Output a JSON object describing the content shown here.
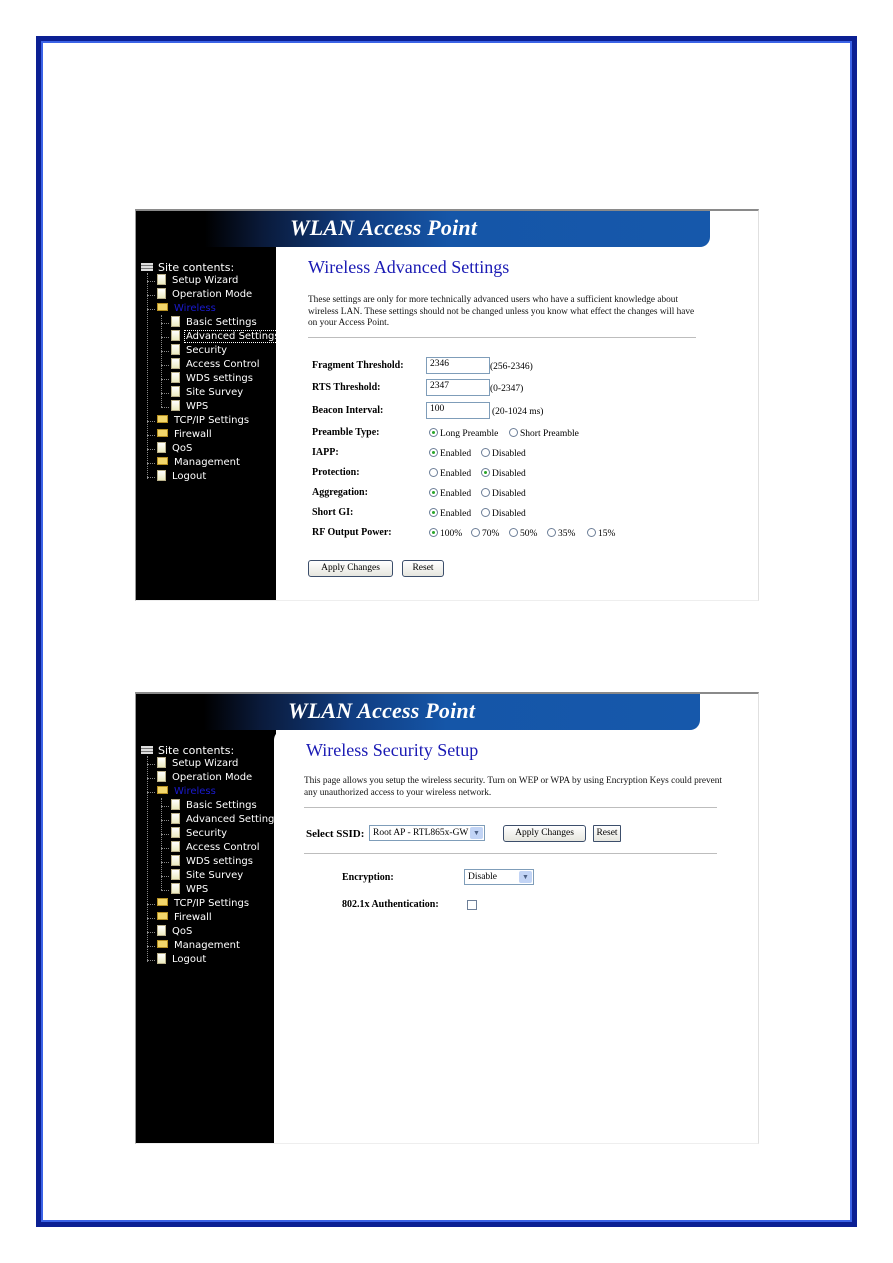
{
  "colors": {
    "page_border": "#0b1f93",
    "banner_blue": "#1658ab",
    "title_blue": "#1a1ab4",
    "sidebar_bg": "#000000"
  },
  "common": {
    "banner_title": "WLAN Access Point",
    "tree": {
      "root": "Site contents:",
      "items": [
        {
          "label": "Setup Wizard",
          "icon": "document-icon"
        },
        {
          "label": "Operation Mode",
          "icon": "document-icon"
        },
        {
          "label": "Wireless",
          "icon": "open-folder-icon"
        },
        {
          "label": "Basic Settings",
          "icon": "document-icon"
        },
        {
          "label": "Advanced Settings",
          "icon": "document-icon"
        },
        {
          "label": "Security",
          "icon": "document-icon"
        },
        {
          "label": "Access Control",
          "icon": "document-icon"
        },
        {
          "label": "WDS settings",
          "icon": "document-icon"
        },
        {
          "label": "Site Survey",
          "icon": "document-icon"
        },
        {
          "label": "WPS",
          "icon": "document-icon"
        },
        {
          "label": "TCP/IP Settings",
          "icon": "folder-icon"
        },
        {
          "label": "Firewall",
          "icon": "folder-icon"
        },
        {
          "label": "QoS",
          "icon": "document-icon"
        },
        {
          "label": "Management",
          "icon": "folder-icon"
        },
        {
          "label": "Logout",
          "icon": "document-icon"
        }
      ]
    }
  },
  "advanced": {
    "title": "Wireless Advanced Settings",
    "description": "These settings are only for more technically advanced users who have a sufficient knowledge about wireless LAN. These settings should not be changed unless you know what effect the changes will have on your Access Point.",
    "fields": [
      {
        "label": "Fragment Threshold:",
        "value": "2346",
        "hint": "(256-2346)"
      },
      {
        "label": "RTS Threshold:",
        "value": "2347",
        "hint": "(0-2347)"
      },
      {
        "label": "Beacon Interval:",
        "value": "100",
        "hint": "(20-1024 ms)"
      }
    ],
    "radios": [
      {
        "label": "Preamble Type:",
        "options": [
          "Long Preamble",
          "Short Preamble"
        ],
        "selected": 0
      },
      {
        "label": "IAPP:",
        "options": [
          "Enabled",
          "Disabled"
        ],
        "selected": 0
      },
      {
        "label": "Protection:",
        "options": [
          "Enabled",
          "Disabled"
        ],
        "selected": 1
      },
      {
        "label": "Aggregation:",
        "options": [
          "Enabled",
          "Disabled"
        ],
        "selected": 0
      },
      {
        "label": "Short GI:",
        "options": [
          "Enabled",
          "Disabled"
        ],
        "selected": 0
      },
      {
        "label": "RF Output Power:",
        "options": [
          "100%",
          "70%",
          "50%",
          "35%",
          "15%"
        ],
        "selected": 0
      }
    ],
    "apply_label": "Apply Changes",
    "reset_label": "Reset"
  },
  "security": {
    "title": "Wireless Security Setup",
    "description": "This page allows you setup the wireless security. Turn on WEP or WPA by using Encryption Keys could prevent any unauthorized access to your wireless network.",
    "ssid_label": "Select SSID:",
    "ssid_value": "Root AP - RTL865x-GW",
    "apply_label": "Apply Changes",
    "reset_label": "Reset",
    "encryption_label": "Encryption:",
    "encryption_value": "Disable",
    "auth_label": "802.1x Authentication:",
    "auth_checked": false
  }
}
